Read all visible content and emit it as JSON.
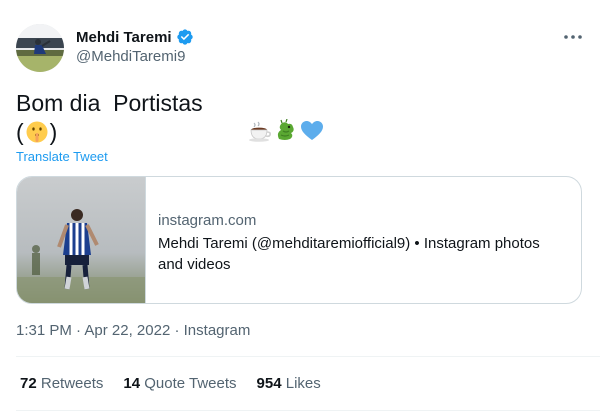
{
  "author": {
    "name": "Mehdi Taremi",
    "handle": "@MehdiTaremi9",
    "verified": true
  },
  "tweet": {
    "line1_text": "Bom dia  Portistas ",
    "line1_emojis": [
      "hot-beverage-emoji",
      "dragon-emoji",
      "blue-heart-emoji"
    ],
    "line2_open": "(",
    "line2_emoji": "shushing-face-emoji",
    "line2_close": ")",
    "translate_label": "Translate Tweet"
  },
  "card": {
    "domain": "instagram.com",
    "title": "Mehdi Taremi (@mehditaremiofficial9) • Instagram photos and videos"
  },
  "meta": {
    "time": "1:31 PM",
    "sep1": " · ",
    "date": "Apr 22, 2022",
    "sep2": " · ",
    "source": "Instagram"
  },
  "stats": {
    "retweets_count": "72",
    "retweets_label": "Retweets",
    "quotes_count": "14",
    "quotes_label": "Quote Tweets",
    "likes_count": "954",
    "likes_label": "Likes"
  },
  "colors": {
    "accent": "#1d9bf0",
    "text_primary": "#0f1419",
    "text_secondary": "#536471",
    "border": "#cfd9de"
  }
}
